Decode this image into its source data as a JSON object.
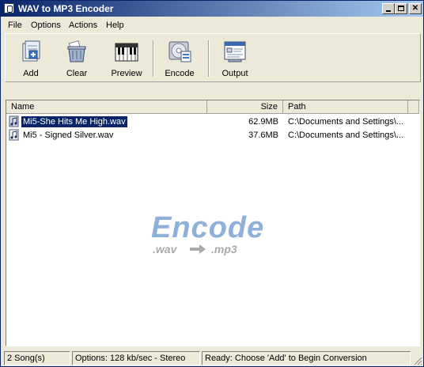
{
  "window": {
    "title": "WAV to MP3 Encoder"
  },
  "menu": {
    "items": [
      "File",
      "Options",
      "Actions",
      "Help"
    ]
  },
  "toolbar": {
    "add_label": "Add",
    "clear_label": "Clear",
    "preview_label": "Preview",
    "encode_label": "Encode",
    "output_label": "Output"
  },
  "list": {
    "columns": {
      "name": "Name",
      "size": "Size",
      "path": "Path"
    },
    "rows": [
      {
        "name": "Mi5-She Hits Me High.wav",
        "size": "62.9MB",
        "path": "C:\\Documents and Settings\\...",
        "selected": true
      },
      {
        "name": "Mi5 - Signed Silver.wav",
        "size": "37.6MB",
        "path": "C:\\Documents and Settings\\...",
        "selected": false
      }
    ]
  },
  "watermark": {
    "title": "Encode",
    "from": ".wav",
    "to": ".mp3"
  },
  "status": {
    "count": "2 Song(s)",
    "options": "Options: 128 kb/sec - Stereo",
    "message": "Ready: Choose 'Add' to Begin Conversion"
  },
  "colors": {
    "title_bar": "#0a246a",
    "selection": "#0a246a",
    "watermark": "#8fb0d8",
    "face": "#ece9d8"
  }
}
